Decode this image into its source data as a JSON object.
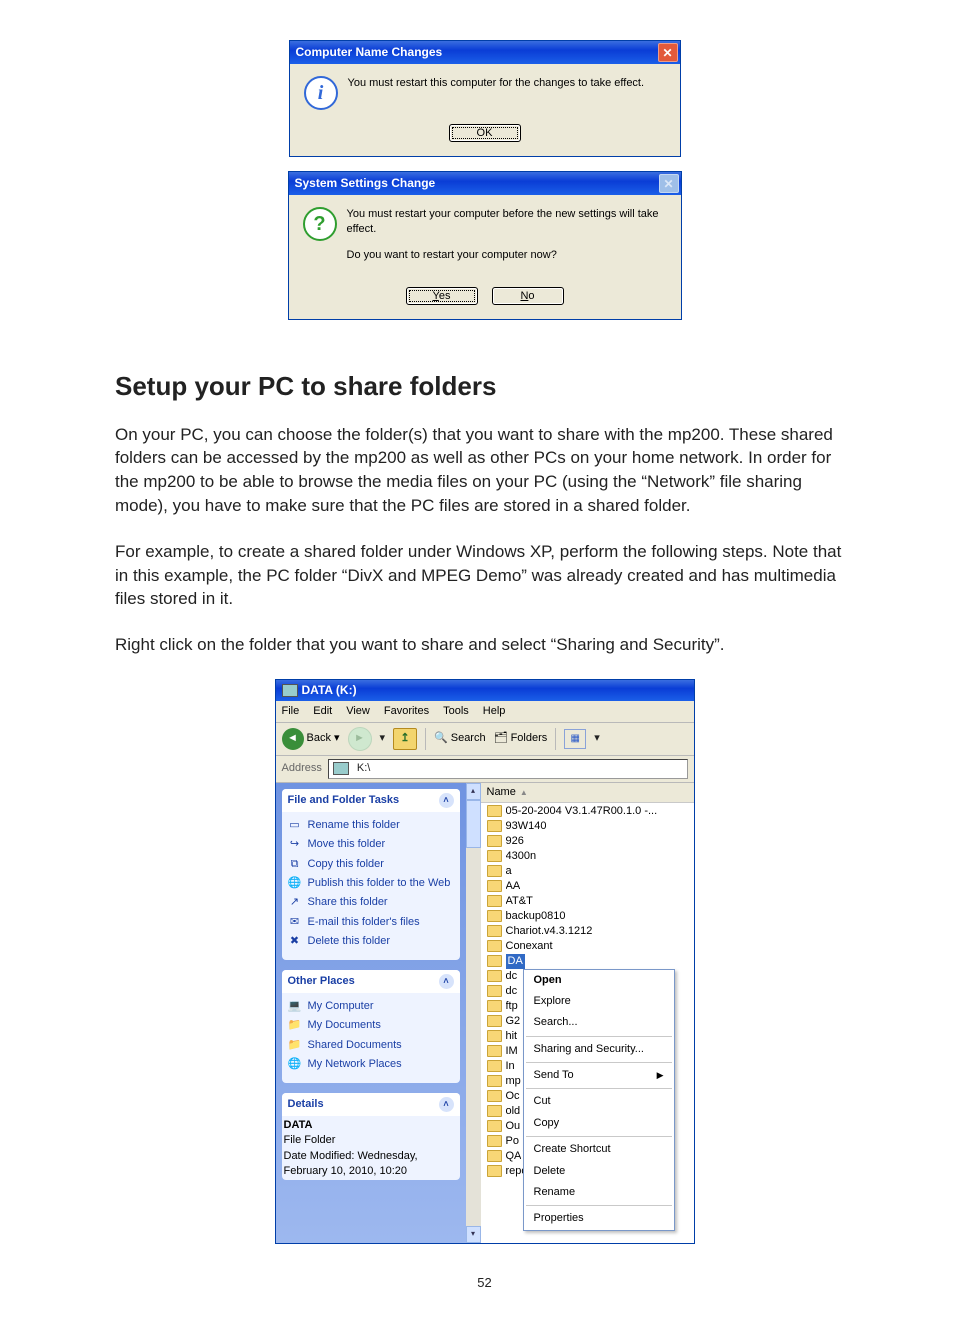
{
  "dialog1": {
    "title": "Computer Name Changes",
    "message": "You must restart this computer for the changes to take effect.",
    "ok": "OK"
  },
  "dialog2": {
    "title": "System Settings Change",
    "message1": "You must restart your computer before the new settings will take effect.",
    "message2": "Do you want to restart your computer now?",
    "yes": "Yes",
    "no": "No"
  },
  "heading": "Setup your PC to share folders",
  "p1": "On your PC, you can choose the folder(s) that you want to share with the mp200. These shared folders can be accessed by the mp200 as well as other PCs on your home network. In order for the mp200 to be able to browse the media files on your PC (using the “Network” file sharing mode), you have to make sure that the PC files are stored in a shared folder.",
  "p2": "For example, to create a shared folder under Windows XP, perform the following steps. Note that in this example, the PC folder “DivX and MPEG Demo” was already created and has multimedia files stored in it.",
  "p3": "Right click on the folder that you want to share and select “Sharing and Security”.",
  "explorer": {
    "title": "DATA (K:)",
    "menus": [
      "File",
      "Edit",
      "View",
      "Favorites",
      "Tools",
      "Help"
    ],
    "toolbar": {
      "back": "Back",
      "search": "Search",
      "folders": "Folders"
    },
    "addressLabel": "Address",
    "addressValue": "K:\\",
    "colName": "Name",
    "tasksPanels": {
      "fileTasks": {
        "title": "File and Folder Tasks",
        "items": [
          "Rename this folder",
          "Move this folder",
          "Copy this folder",
          "Publish this folder to the Web",
          "Share this folder",
          "E-mail this folder's files",
          "Delete this folder"
        ]
      },
      "otherPlaces": {
        "title": "Other Places",
        "items": [
          "My Computer",
          "My Documents",
          "Shared Documents",
          "My Network Places"
        ]
      },
      "details": {
        "title": "Details",
        "name": "DATA",
        "type": "File Folder",
        "modified": "Date Modified: Wednesday, February 10, 2010, 10:20"
      }
    },
    "folders": [
      "05-20-2004 V3.1.47R00.1.0 -...",
      "93W140",
      "926",
      "4300n",
      "a",
      "AA",
      "AT&T",
      "backup0810",
      "Chariot.v4.3.1212",
      "Conexant",
      "DA",
      "dc",
      "dc",
      "ftp",
      "G2",
      "hit",
      "IM",
      "In",
      "mp",
      "Oc",
      "old",
      "Ou",
      "Po",
      "QA",
      "reports"
    ],
    "selectedIndex": 10,
    "context": {
      "items": [
        {
          "label": "Open",
          "bold": true
        },
        {
          "label": "Explore"
        },
        {
          "label": "Search..."
        },
        {
          "sep": true
        },
        {
          "label": "Sharing and Security..."
        },
        {
          "sep": true
        },
        {
          "label": "Send To",
          "submenu": true
        },
        {
          "sep": true
        },
        {
          "label": "Cut"
        },
        {
          "label": "Copy"
        },
        {
          "sep": true
        },
        {
          "label": "Create Shortcut"
        },
        {
          "label": "Delete"
        },
        {
          "label": "Rename"
        },
        {
          "sep": true
        },
        {
          "label": "Properties"
        }
      ]
    }
  },
  "pageNumber": "52"
}
